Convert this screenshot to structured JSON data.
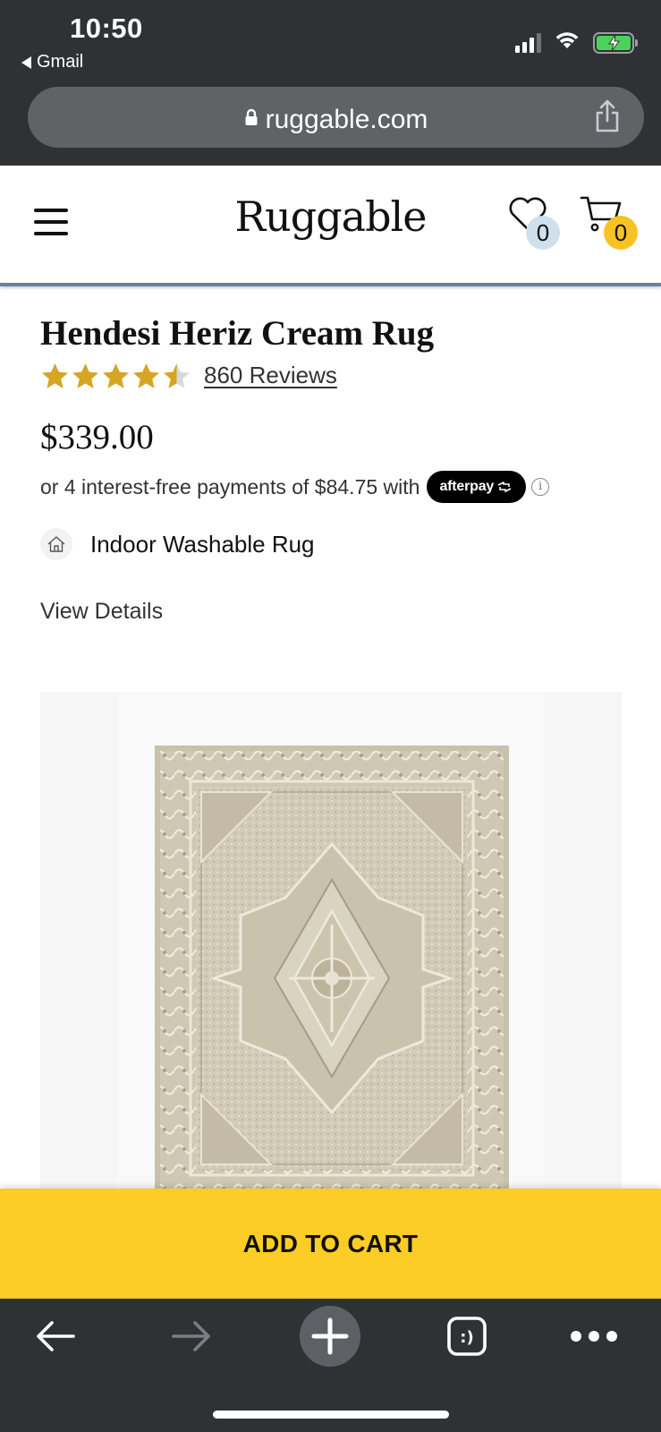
{
  "status_bar": {
    "time": "10:50",
    "back_app": "Gmail",
    "signal_bars": 3,
    "signal_bars_total": 4,
    "battery_level": 1.0,
    "battery_charging": true
  },
  "browser": {
    "url": "ruggable.com"
  },
  "header": {
    "logo": "Ruggable",
    "wishlist_count": "0",
    "cart_count": "0"
  },
  "product": {
    "title": "Hendesi Heriz Cream Rug",
    "rating": 4.5,
    "rating_max": 5,
    "reviews_label": "860 Reviews",
    "price": "$339.00",
    "installments_text": "or 4 interest-free payments of $84.75 with",
    "afterpay_label": "afterpay",
    "info_icon": "i",
    "rug_type": "Indoor Washable Rug",
    "view_details": "View Details"
  },
  "add_to_cart": {
    "label": "ADD TO CART"
  },
  "colors": {
    "chrome": "#2f3235",
    "accent_yellow": "#fccc27",
    "star_gold": "#d6a521",
    "header_rule": "#6f7da8",
    "rug_base": "#d2cbb8"
  }
}
